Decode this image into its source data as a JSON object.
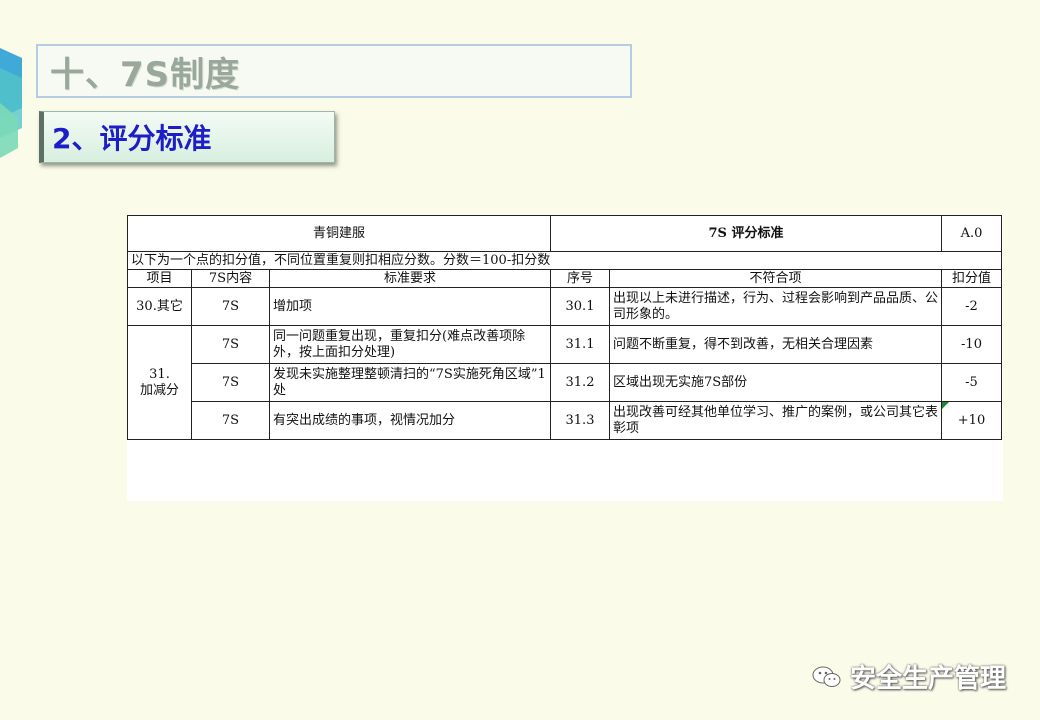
{
  "slide": {
    "title": "十、7S制度",
    "subtitle": "2、评分标准"
  },
  "sheet": {
    "company": "青铜建服",
    "standard_title": "7S 评分标准",
    "version": "A.0",
    "note": "以下为一个点的扣分值，不同位置重复则扣相应分数。分数＝100-扣分数",
    "columns": [
      "项目",
      "7S内容",
      "标准要求",
      "序号",
      "不符合项",
      "扣分值"
    ],
    "rows": [
      {
        "item": "30.其它",
        "content": "7S",
        "requirement": "增加项",
        "no": "30.1",
        "nonconformity": "出现以上未进行描述，行为、过程会影响到产品品质、公司形象的。",
        "score": "-2"
      },
      {
        "item": "31.\n加减分",
        "content": "7S",
        "requirement": "同一问题重复出现，重复扣分(难点改善项除外，按上面扣分处理)",
        "no": "31.1",
        "nonconformity": "问题不断重复，得不到改善，无相关合理因素",
        "score": "-10"
      },
      {
        "item": "",
        "content": "7S",
        "requirement": "发现未实施整理整顿清扫的“7S实施死角区域”1处",
        "no": "31.2",
        "nonconformity": "区域出现无实施7S部份",
        "score": "-5"
      },
      {
        "item": "",
        "content": "7S",
        "requirement": "有突出成绩的事项，视情况加分",
        "no": "31.3",
        "nonconformity": "出现改善可经其他单位学习、推广的案例，或公司其它表彰项",
        "score": "+10"
      }
    ]
  },
  "watermark": {
    "text": "安全生产管理",
    "icon": "wechat-icon"
  },
  "colors": {
    "background": "#fbfbe9",
    "subtitle_text": "#1e1ec8",
    "title_text": "#9aa89c"
  }
}
